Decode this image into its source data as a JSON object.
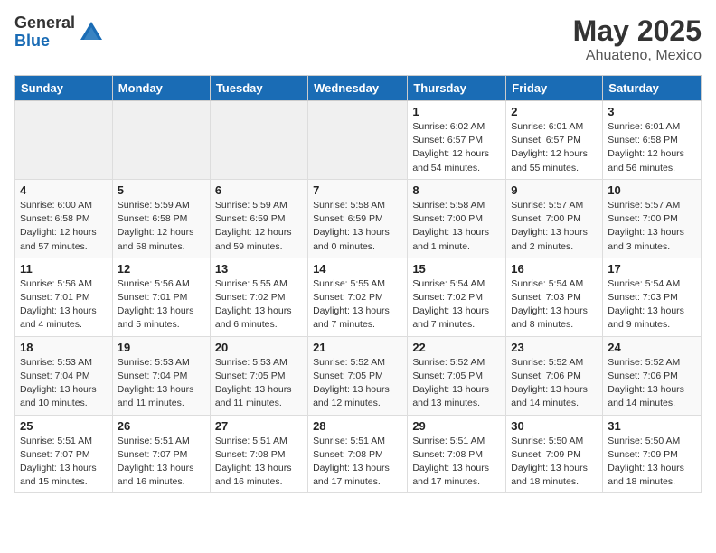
{
  "logo": {
    "general": "General",
    "blue": "Blue"
  },
  "title": "May 2025",
  "subtitle": "Ahuateno, Mexico",
  "weekdays": [
    "Sunday",
    "Monday",
    "Tuesday",
    "Wednesday",
    "Thursday",
    "Friday",
    "Saturday"
  ],
  "weeks": [
    [
      {
        "day": "",
        "detail": ""
      },
      {
        "day": "",
        "detail": ""
      },
      {
        "day": "",
        "detail": ""
      },
      {
        "day": "",
        "detail": ""
      },
      {
        "day": "1",
        "detail": "Sunrise: 6:02 AM\nSunset: 6:57 PM\nDaylight: 12 hours and 54 minutes."
      },
      {
        "day": "2",
        "detail": "Sunrise: 6:01 AM\nSunset: 6:57 PM\nDaylight: 12 hours and 55 minutes."
      },
      {
        "day": "3",
        "detail": "Sunrise: 6:01 AM\nSunset: 6:58 PM\nDaylight: 12 hours and 56 minutes."
      }
    ],
    [
      {
        "day": "4",
        "detail": "Sunrise: 6:00 AM\nSunset: 6:58 PM\nDaylight: 12 hours and 57 minutes."
      },
      {
        "day": "5",
        "detail": "Sunrise: 5:59 AM\nSunset: 6:58 PM\nDaylight: 12 hours and 58 minutes."
      },
      {
        "day": "6",
        "detail": "Sunrise: 5:59 AM\nSunset: 6:59 PM\nDaylight: 12 hours and 59 minutes."
      },
      {
        "day": "7",
        "detail": "Sunrise: 5:58 AM\nSunset: 6:59 PM\nDaylight: 13 hours and 0 minutes."
      },
      {
        "day": "8",
        "detail": "Sunrise: 5:58 AM\nSunset: 7:00 PM\nDaylight: 13 hours and 1 minute."
      },
      {
        "day": "9",
        "detail": "Sunrise: 5:57 AM\nSunset: 7:00 PM\nDaylight: 13 hours and 2 minutes."
      },
      {
        "day": "10",
        "detail": "Sunrise: 5:57 AM\nSunset: 7:00 PM\nDaylight: 13 hours and 3 minutes."
      }
    ],
    [
      {
        "day": "11",
        "detail": "Sunrise: 5:56 AM\nSunset: 7:01 PM\nDaylight: 13 hours and 4 minutes."
      },
      {
        "day": "12",
        "detail": "Sunrise: 5:56 AM\nSunset: 7:01 PM\nDaylight: 13 hours and 5 minutes."
      },
      {
        "day": "13",
        "detail": "Sunrise: 5:55 AM\nSunset: 7:02 PM\nDaylight: 13 hours and 6 minutes."
      },
      {
        "day": "14",
        "detail": "Sunrise: 5:55 AM\nSunset: 7:02 PM\nDaylight: 13 hours and 7 minutes."
      },
      {
        "day": "15",
        "detail": "Sunrise: 5:54 AM\nSunset: 7:02 PM\nDaylight: 13 hours and 7 minutes."
      },
      {
        "day": "16",
        "detail": "Sunrise: 5:54 AM\nSunset: 7:03 PM\nDaylight: 13 hours and 8 minutes."
      },
      {
        "day": "17",
        "detail": "Sunrise: 5:54 AM\nSunset: 7:03 PM\nDaylight: 13 hours and 9 minutes."
      }
    ],
    [
      {
        "day": "18",
        "detail": "Sunrise: 5:53 AM\nSunset: 7:04 PM\nDaylight: 13 hours and 10 minutes."
      },
      {
        "day": "19",
        "detail": "Sunrise: 5:53 AM\nSunset: 7:04 PM\nDaylight: 13 hours and 11 minutes."
      },
      {
        "day": "20",
        "detail": "Sunrise: 5:53 AM\nSunset: 7:05 PM\nDaylight: 13 hours and 11 minutes."
      },
      {
        "day": "21",
        "detail": "Sunrise: 5:52 AM\nSunset: 7:05 PM\nDaylight: 13 hours and 12 minutes."
      },
      {
        "day": "22",
        "detail": "Sunrise: 5:52 AM\nSunset: 7:05 PM\nDaylight: 13 hours and 13 minutes."
      },
      {
        "day": "23",
        "detail": "Sunrise: 5:52 AM\nSunset: 7:06 PM\nDaylight: 13 hours and 14 minutes."
      },
      {
        "day": "24",
        "detail": "Sunrise: 5:52 AM\nSunset: 7:06 PM\nDaylight: 13 hours and 14 minutes."
      }
    ],
    [
      {
        "day": "25",
        "detail": "Sunrise: 5:51 AM\nSunset: 7:07 PM\nDaylight: 13 hours and 15 minutes."
      },
      {
        "day": "26",
        "detail": "Sunrise: 5:51 AM\nSunset: 7:07 PM\nDaylight: 13 hours and 16 minutes."
      },
      {
        "day": "27",
        "detail": "Sunrise: 5:51 AM\nSunset: 7:08 PM\nDaylight: 13 hours and 16 minutes."
      },
      {
        "day": "28",
        "detail": "Sunrise: 5:51 AM\nSunset: 7:08 PM\nDaylight: 13 hours and 17 minutes."
      },
      {
        "day": "29",
        "detail": "Sunrise: 5:51 AM\nSunset: 7:08 PM\nDaylight: 13 hours and 17 minutes."
      },
      {
        "day": "30",
        "detail": "Sunrise: 5:50 AM\nSunset: 7:09 PM\nDaylight: 13 hours and 18 minutes."
      },
      {
        "day": "31",
        "detail": "Sunrise: 5:50 AM\nSunset: 7:09 PM\nDaylight: 13 hours and 18 minutes."
      }
    ]
  ]
}
